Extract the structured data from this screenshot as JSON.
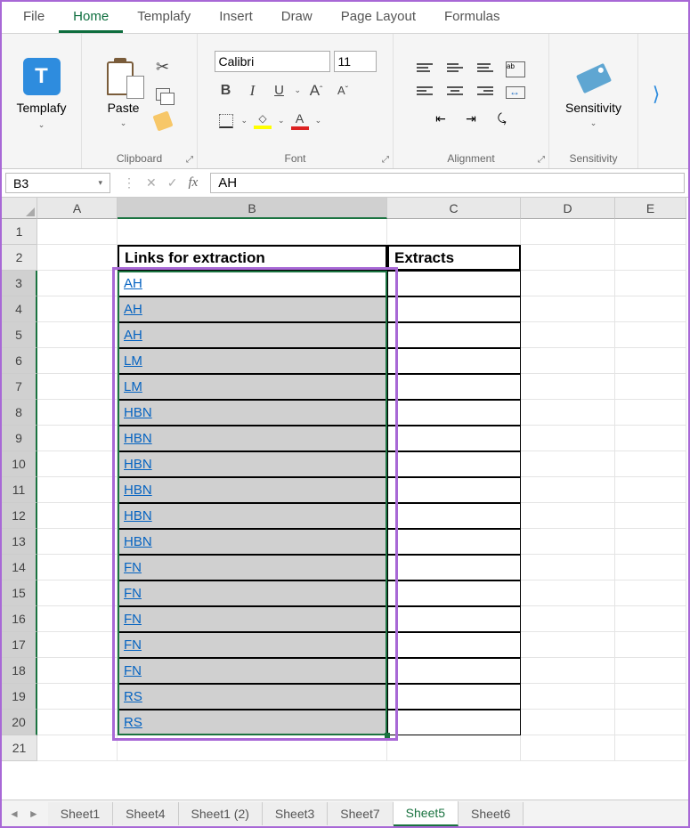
{
  "tabs": {
    "file": "File",
    "home": "Home",
    "templafy": "Templafy",
    "insert": "Insert",
    "draw": "Draw",
    "pagelayout": "Page Layout",
    "formulas": "Formulas"
  },
  "groups": {
    "clipboard": "Clipboard",
    "font": "Font",
    "alignment": "Alignment",
    "sensitivity_group": "Sensitivity"
  },
  "buttons": {
    "templafy": "Templafy",
    "paste": "Paste",
    "sensitivity": "Sensitivity"
  },
  "font": {
    "name": "Calibri",
    "size": "11",
    "bold": "B",
    "italic": "I",
    "underline": "U"
  },
  "namebox": "B3",
  "formula_value": "AH",
  "columns": [
    "A",
    "B",
    "C",
    "D",
    "E"
  ],
  "rows": [
    "1",
    "2",
    "3",
    "4",
    "5",
    "6",
    "7",
    "8",
    "9",
    "10",
    "11",
    "12",
    "13",
    "14",
    "15",
    "16",
    "17",
    "18",
    "19",
    "20",
    "21"
  ],
  "table": {
    "header_b": "Links for extraction",
    "header_c": "Extracts",
    "links": [
      "AH",
      "AH",
      "AH",
      "LM",
      "LM",
      "HBN",
      "HBN",
      "HBN",
      "HBN",
      "HBN",
      "HBN",
      "FN",
      "FN",
      "FN",
      "FN",
      "FN",
      "RS",
      "RS"
    ]
  },
  "sheets": {
    "s1": "Sheet1",
    "s2": "Sheet4",
    "s3": "Sheet1 (2)",
    "s4": "Sheet3",
    "s5": "Sheet7",
    "s6": "Sheet5",
    "s7": "Sheet6"
  },
  "glyphs": {
    "cut": "✂",
    "check": "✓",
    "x": "✕",
    "down": "⌄",
    "ellipsis": "⋮",
    "left": "◄",
    "right": "►"
  }
}
